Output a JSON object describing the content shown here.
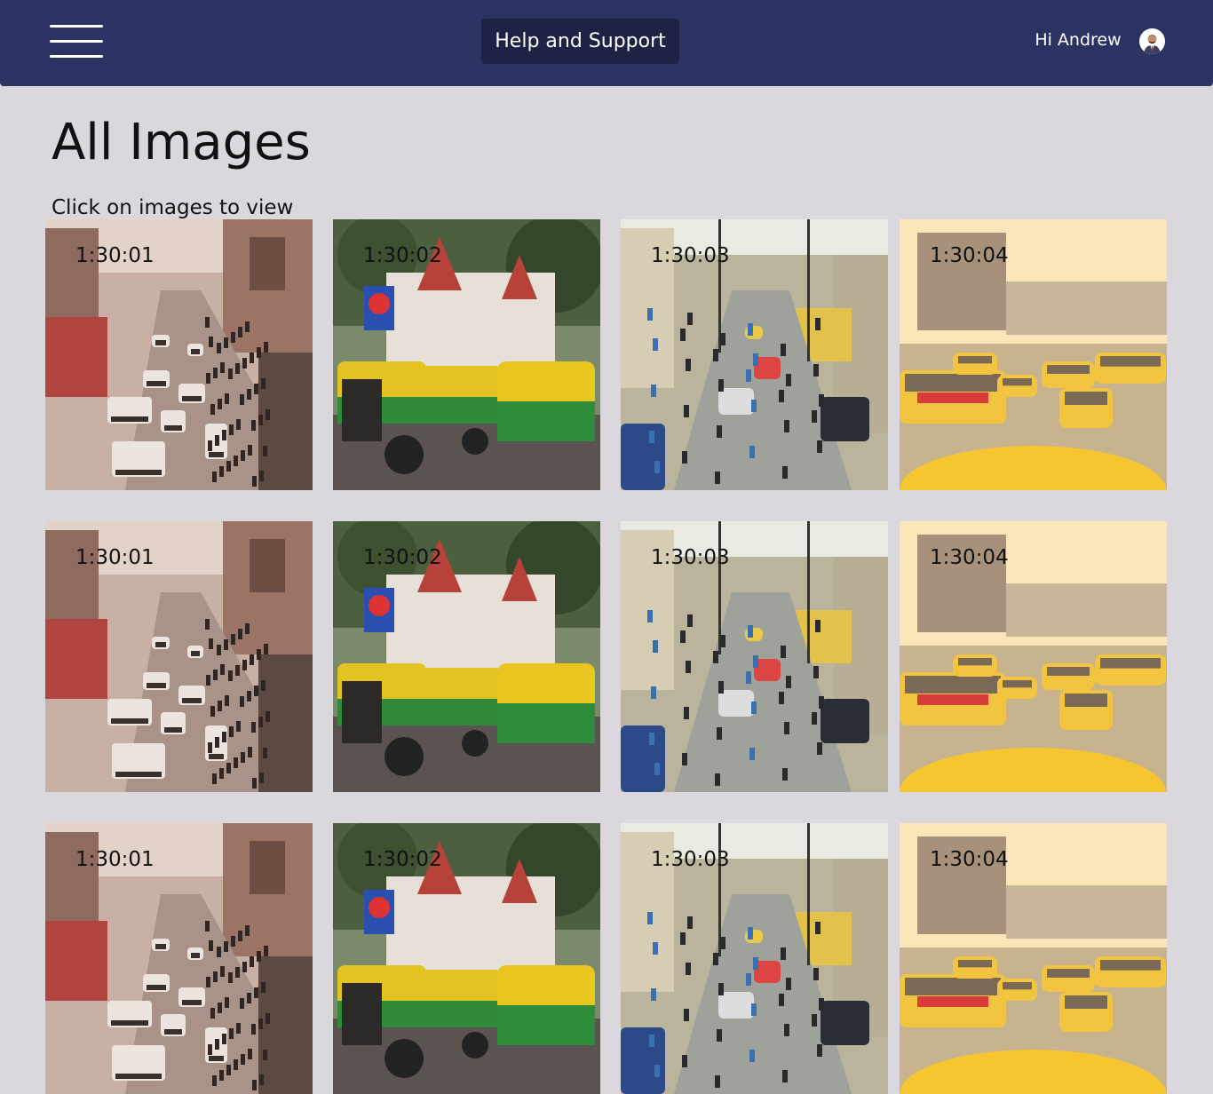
{
  "header": {
    "help_label": "Help and Support",
    "greeting": "Hi Andrew"
  },
  "main": {
    "title": "All Images",
    "subtitle": "Click on images to view",
    "rows": [
      [
        {
          "timestamp": "1:30:01",
          "scene": "crowded-street"
        },
        {
          "timestamp": "1:30:02",
          "scene": "rickshaws-temple"
        },
        {
          "timestamp": "1:30:03",
          "scene": "busy-market-street"
        },
        {
          "timestamp": "1:30:04",
          "scene": "yellow-taxis"
        }
      ],
      [
        {
          "timestamp": "1:30:01",
          "scene": "crowded-street"
        },
        {
          "timestamp": "1:30:02",
          "scene": "rickshaws-temple"
        },
        {
          "timestamp": "1:30:03",
          "scene": "busy-market-street"
        },
        {
          "timestamp": "1:30:04",
          "scene": "yellow-taxis"
        }
      ],
      [
        {
          "timestamp": "1:30:01",
          "scene": "crowded-street"
        },
        {
          "timestamp": "1:30:02",
          "scene": "rickshaws-temple"
        },
        {
          "timestamp": "1:30:03",
          "scene": "busy-market-street"
        },
        {
          "timestamp": "1:30:04",
          "scene": "yellow-taxis"
        }
      ]
    ]
  },
  "colors": {
    "header_bg": "#2c3262",
    "help_button_bg": "#1e2346",
    "page_bg": "#dbd8dd"
  },
  "icons": {
    "menu": "hamburger-menu-icon",
    "avatar": "user-avatar-icon"
  }
}
